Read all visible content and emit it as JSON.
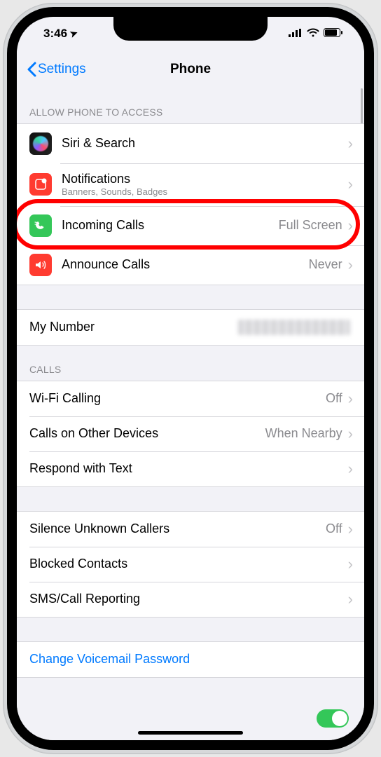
{
  "status": {
    "time": "3:46",
    "locationGlyph": "➤"
  },
  "nav": {
    "back": "Settings",
    "title": "Phone"
  },
  "section1": {
    "header": "ALLOW PHONE TO ACCESS",
    "rows": [
      {
        "title": "Siri & Search",
        "sub": ""
      },
      {
        "title": "Notifications",
        "sub": "Banners, Sounds, Badges"
      },
      {
        "title": "Incoming Calls",
        "value": "Full Screen"
      },
      {
        "title": "Announce Calls",
        "value": "Never"
      }
    ]
  },
  "myNumber": {
    "title": "My Number"
  },
  "section2": {
    "header": "CALLS",
    "rows": [
      {
        "title": "Wi-Fi Calling",
        "value": "Off"
      },
      {
        "title": "Calls on Other Devices",
        "value": "When Nearby"
      },
      {
        "title": "Respond with Text",
        "value": ""
      }
    ]
  },
  "section3": {
    "rows": [
      {
        "title": "Silence Unknown Callers",
        "value": "Off"
      },
      {
        "title": "Blocked Contacts",
        "value": ""
      },
      {
        "title": "SMS/Call Reporting",
        "value": ""
      }
    ]
  },
  "section4": {
    "rows": [
      {
        "title": "Change Voicemail Password"
      }
    ]
  }
}
